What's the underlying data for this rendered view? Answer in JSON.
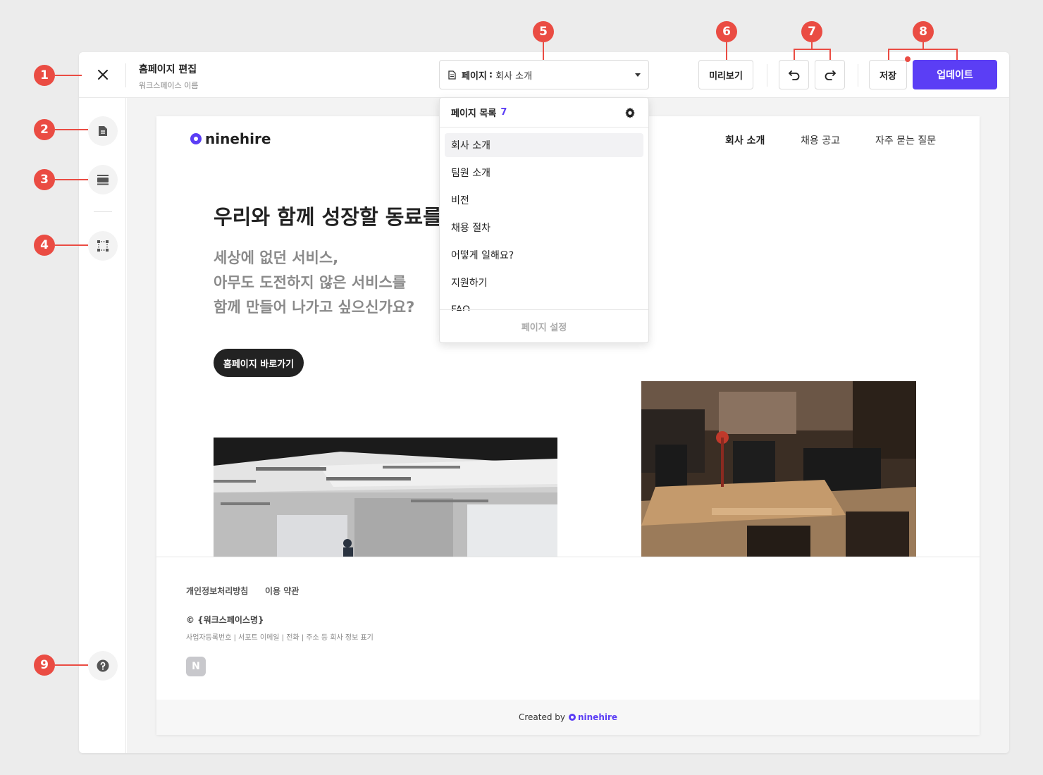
{
  "header": {
    "title": "홈페이지 편집",
    "workspace": "워크스페이스 이름",
    "page_select_label": "페이지",
    "page_select_sep": ":",
    "page_select_value": "회사 소개",
    "preview_label": "미리보기",
    "save_label": "저장",
    "update_label": "업데이트"
  },
  "markers": [
    "1",
    "2",
    "3",
    "4",
    "5",
    "6",
    "7",
    "8",
    "9"
  ],
  "dropdown": {
    "title": "페이지 목록",
    "count": "7",
    "items": [
      {
        "label": "회사 소개",
        "active": true
      },
      {
        "label": "팀원 소개"
      },
      {
        "label": "비전"
      },
      {
        "label": "채용 절차"
      },
      {
        "label": "어떻게 일해요?"
      },
      {
        "label": "지원하기"
      },
      {
        "label": "FAQ"
      }
    ],
    "footer": "페이지 설정"
  },
  "site": {
    "logo": "ninehire",
    "nav": [
      "회사 소개",
      "채용 공고",
      "자주 묻는 질문"
    ],
    "hero_title": "우리와 함께 성장할 동료를 찾습니다",
    "hero_sub": [
      "세상에 없던 서비스,",
      "아무도 도전하지 않은 서비스를",
      "함께 만들어 나가고 싶으신가요?"
    ],
    "cta": "홈페이지 바로가기",
    "footer": {
      "privacy": "개인정보처리방침",
      "terms": "이용 약관",
      "copyright": "© {워크스페이스명}",
      "info": "사업자등록번호 | 서포트 이메일 | 전화 | 주소 등 회사 정보 표기",
      "badge": "N"
    },
    "created_by": "Created by",
    "created_brand": "ninehire"
  },
  "colors": {
    "accent": "#5b3ef5",
    "marker": "#ea4c43"
  }
}
